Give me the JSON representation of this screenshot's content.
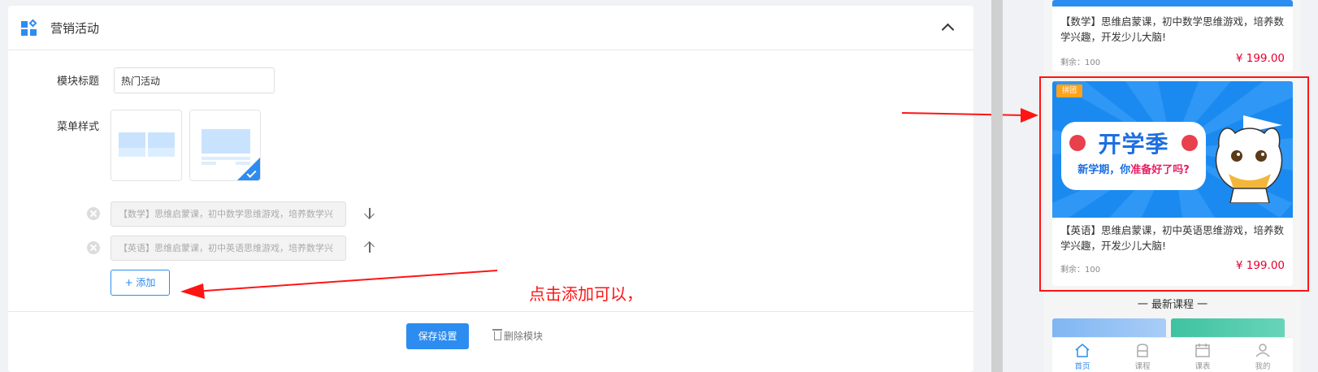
{
  "module": {
    "title": "营销活动",
    "title_label": "模块标题",
    "title_value": "热门活动",
    "menu_style_label": "菜单样式",
    "items": [
      {
        "text": "【数学】思维启蒙课，初中数学思维游戏，培养数学兴"
      },
      {
        "text": "【英语】思维启蒙课，初中英语思维游戏，培养数学兴"
      }
    ],
    "add_label": "+  添加",
    "save_label": "保存设置",
    "delete_label": "删除模块"
  },
  "annotation": {
    "text": "点击添加可以，"
  },
  "preview": {
    "course1": {
      "title": "【数学】思维启蒙课，初中数学思维游戏，培养数学兴趣，开发少儿大脑!",
      "remain": "剩余：100",
      "price": "¥ 199.00"
    },
    "course2": {
      "tag": "拼团",
      "banner_title": "开学季",
      "banner_sub_pre": "新学期，你",
      "banner_sub_hl": "准备好了吗?",
      "title": "【英语】思维启蒙课，初中英语思维游戏，培养数学兴趣，开发少儿大脑!",
      "remain": "剩余：100",
      "price": "¥ 199.00"
    },
    "section_title": "一 最新课程 一",
    "tabs": [
      {
        "label": "首页"
      },
      {
        "label": "课程"
      },
      {
        "label": "课表"
      },
      {
        "label": "我的"
      }
    ]
  },
  "colors": {
    "primary": "#2d8cf0",
    "annotation_red": "#ff1414",
    "price_red": "#e6002d",
    "tag_orange": "#ffa31a"
  }
}
